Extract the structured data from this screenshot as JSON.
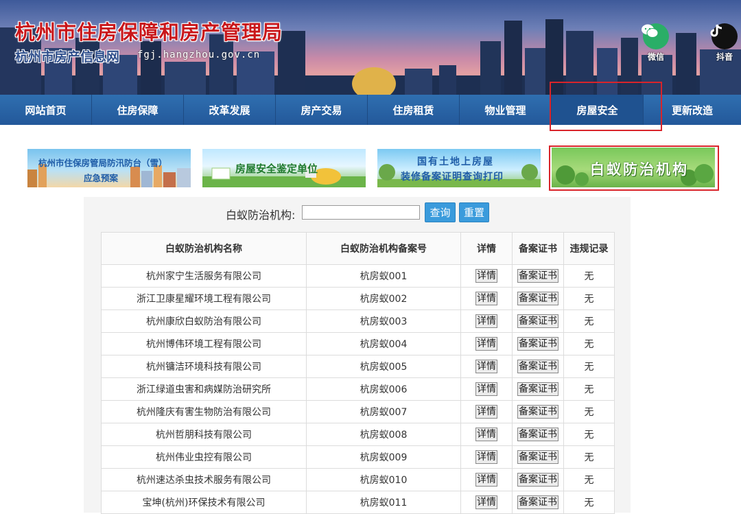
{
  "header": {
    "site_title": "杭州市住房保障和房产管理局",
    "site_subtitle": "杭州市房产信息网",
    "domain": "fgj.hangzhou.gov.cn",
    "social": [
      {
        "label": "微信",
        "icon": "wechat-icon"
      },
      {
        "label": "抖音",
        "icon": "tiktok-icon"
      }
    ]
  },
  "nav": {
    "items": [
      {
        "label": "网站首页"
      },
      {
        "label": "住房保障"
      },
      {
        "label": "改革发展"
      },
      {
        "label": "房产交易"
      },
      {
        "label": "住房租赁"
      },
      {
        "label": "物业管理"
      },
      {
        "label": "房屋安全",
        "active": true
      },
      {
        "label": "更新改造"
      }
    ]
  },
  "tiles": {
    "t1_line1": "杭州市住保房管局防汛防台（雪）",
    "t1_line2": "应急预案",
    "t2": "房屋安全鉴定单位",
    "t3_line1": "国有土地上房屋",
    "t3_line2": "装修备案证明查询打印",
    "t4": "白蚁防治机构"
  },
  "search": {
    "label": "白蚁防治机构:",
    "value": "",
    "placeholder": "",
    "query_button": "查询",
    "reset_button": "重置"
  },
  "table": {
    "headers": [
      "白蚁防治机构名称",
      "白蚁防治机构备案号",
      "详情",
      "备案证书",
      "违规记录"
    ],
    "detail_label": "详情",
    "cert_label": "备案证书",
    "rows": [
      {
        "name": "杭州家宁生活服务有限公司",
        "code": "杭房蚁001",
        "record": "无"
      },
      {
        "name": "浙江卫康星耀环境工程有限公司",
        "code": "杭房蚁002",
        "record": "无"
      },
      {
        "name": "杭州康欣白蚁防治有限公司",
        "code": "杭房蚁003",
        "record": "无"
      },
      {
        "name": "杭州博伟环境工程有限公司",
        "code": "杭房蚁004",
        "record": "无"
      },
      {
        "name": "杭州镛洁环境科技有限公司",
        "code": "杭房蚁005",
        "record": "无"
      },
      {
        "name": "浙江绿道虫害和病媒防治研究所",
        "code": "杭房蚁006",
        "record": "无"
      },
      {
        "name": "杭州隆庆有害生物防治有限公司",
        "code": "杭房蚁007",
        "record": "无"
      },
      {
        "name": "杭州哲朋科技有限公司",
        "code": "杭房蚁008",
        "record": "无"
      },
      {
        "name": "杭州伟业虫控有限公司",
        "code": "杭房蚁009",
        "record": "无"
      },
      {
        "name": "杭州速达杀虫技术服务有限公司",
        "code": "杭房蚁010",
        "record": "无"
      },
      {
        "name": "宝坤(杭州)环保技术有限公司",
        "code": "杭房蚁011",
        "record": "无"
      }
    ]
  },
  "colors": {
    "nav_bg": "#2a62a6",
    "highlight_border": "#d9242a",
    "button": "#3a9bdc",
    "title_red": "#c9171b"
  }
}
